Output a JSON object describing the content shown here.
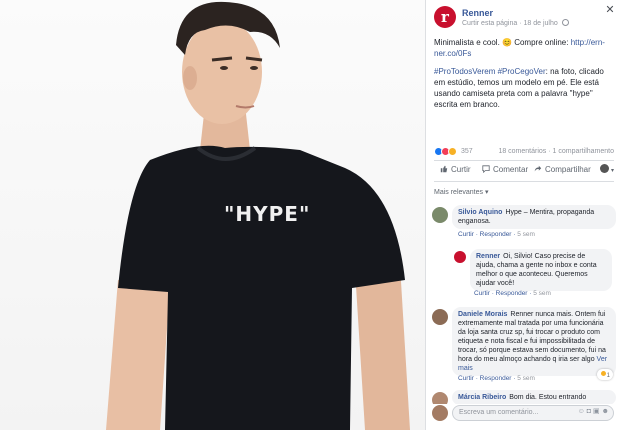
{
  "post": {
    "page_name": "Renner",
    "page_logo_letter": "r",
    "meta_prefix": "Curtir esta página",
    "meta_date": "18 de julho",
    "text_line1": "Minimalista e cool. 😊 Compre online: ",
    "text_link": "http://ern-ner.co/0Fs",
    "hashtags": "#ProTodosVerem #ProCegoVer",
    "text_line2": ": na foto, clicado em estúdio, temos um modelo em pé. Ele está usando camiseta preta com a palavra \"hype\" escrita em branco.",
    "reaction_count": "357",
    "comments_shares": "18 comentários · 1 compartilhamento",
    "shirt_print": "\"HYPE\""
  },
  "actions": {
    "like": "Curtir",
    "comment": "Comentar",
    "share": "Compartilhar"
  },
  "comments_filter": "Mais relevantes ▾",
  "comments": [
    {
      "author": "Silvio Aquino",
      "text": "Hype – Mentira, propaganda enganosa.",
      "like": "Curtir",
      "reply": "Responder",
      "time": "5 sem"
    },
    {
      "author": "Renner",
      "text": "Oi, Silvio! Caso precise de ajuda, chama a gente no inbox e conta melhor o que aconteceu. Queremos ajudar você!",
      "like": "Curtir",
      "reply": "Responder",
      "time": "5 sem"
    },
    {
      "author": "Daniele Morais",
      "text": "Renner nunca mais. Ontem fui extremamente mal tratada por uma funcionária da loja santa cruz sp, fui trocar o produto com etiqueta e nota fiscal e fui impossibilitada de trocar, só porque estava sem documento, fui na hora do meu almoço achando q iria ser algo",
      "see_more": "Ver mais",
      "reaction_count": "1",
      "like": "Curtir",
      "reply": "Responder",
      "time": "5 sem"
    },
    {
      "author": "Márcia Ribeiro",
      "text": "Bom dia. Estou entrando"
    }
  ],
  "comment_box": {
    "placeholder": "Escreva um comentário..."
  },
  "colors": {
    "brand": "#c8102e",
    "link": "#385898",
    "shirt": "#15171c"
  }
}
